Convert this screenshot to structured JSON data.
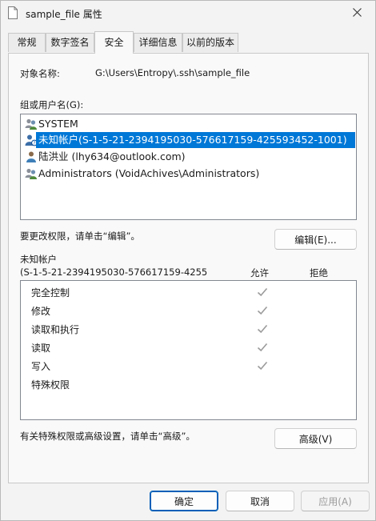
{
  "window": {
    "title": "sample_file 属性",
    "close_icon": "close-icon",
    "file_icon": "document-icon"
  },
  "tabs": [
    {
      "label": "常规",
      "active": false
    },
    {
      "label": "数字签名",
      "active": false
    },
    {
      "label": "安全",
      "active": true
    },
    {
      "label": "详细信息",
      "active": false
    },
    {
      "label": "以前的版本",
      "active": false
    }
  ],
  "security": {
    "object_name_label": "对象名称:",
    "object_name_value": "G:\\Users\\Entropy\\.ssh\\sample_file",
    "group_label": "组或用户名(G):",
    "users": [
      {
        "name": "SYSTEM",
        "icon": "user-group-icon",
        "selected": false
      },
      {
        "name": "未知帐户(S-1-5-21-2394195030-576617159-425593452-1001)",
        "icon": "unknown-user-icon",
        "selected": true
      },
      {
        "name": "陆洪业 (lhy634@outlook.com)",
        "icon": "user-icon",
        "selected": false
      },
      {
        "name": "Administrators (VoidAchives\\Administrators)",
        "icon": "user-group-icon",
        "selected": false
      }
    ],
    "edit_hint": "要更改权限，请单击“编辑”。",
    "edit_button": "编辑(E)...",
    "perm_for_line1": "未知帐户",
    "perm_for_line2": "(S-1-5-21-2394195030-576617159-4255",
    "allow_header": "允许",
    "deny_header": "拒绝",
    "permissions": [
      {
        "name": "完全控制",
        "allow": true,
        "deny": false
      },
      {
        "name": "修改",
        "allow": true,
        "deny": false
      },
      {
        "name": "读取和执行",
        "allow": true,
        "deny": false
      },
      {
        "name": "读取",
        "allow": true,
        "deny": false
      },
      {
        "name": "写入",
        "allow": true,
        "deny": false
      },
      {
        "name": "特殊权限",
        "allow": false,
        "deny": false
      }
    ],
    "advanced_hint": "有关特殊权限或高级设置，请单击“高级”。",
    "advanced_button": "高级(V)"
  },
  "footer": {
    "ok": "确定",
    "cancel": "取消",
    "apply": "应用(A)"
  },
  "colors": {
    "selection": "#0078d7",
    "check_gray": "#9a9a9a",
    "primary_border": "#005fb8"
  }
}
